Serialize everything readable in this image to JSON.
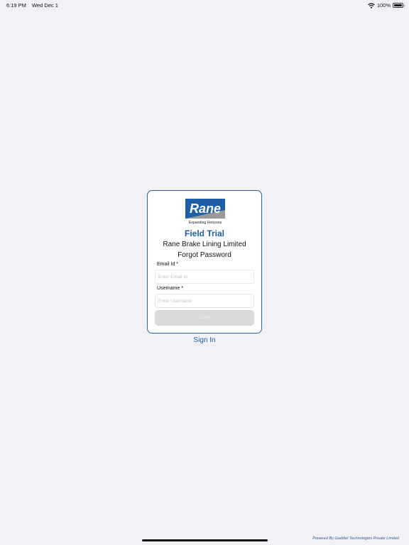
{
  "status_bar": {
    "time": "6:19 PM",
    "date": "Wed Dec 1",
    "battery": "100%",
    "wifi_icon": "wifi-icon",
    "battery_icon": "battery-icon"
  },
  "logo": {
    "brand": "Rane",
    "tagline": "Expanding Horizons",
    "brand_color": "#1f5ea8"
  },
  "app_title": "Field Trial",
  "company_name": "Rane Brake Lining Limited",
  "page_heading": "Forgot Password",
  "form": {
    "email_label": "Email Id *",
    "email_placeholder": "Enter Email Id",
    "email_value": "",
    "username_label": "Username *",
    "username_placeholder": "Enter Username",
    "username_value": "",
    "submit_label": "Submit"
  },
  "sign_in_label": "Sign In",
  "footer": {
    "powered_by": "Powered By Gaddiel Technologies Private Limited"
  },
  "colors": {
    "background": "#f2f1f6",
    "accent": "#1f5ea8",
    "card_border": "#2f5e9c",
    "submit_disabled": "#d9d9d9"
  }
}
